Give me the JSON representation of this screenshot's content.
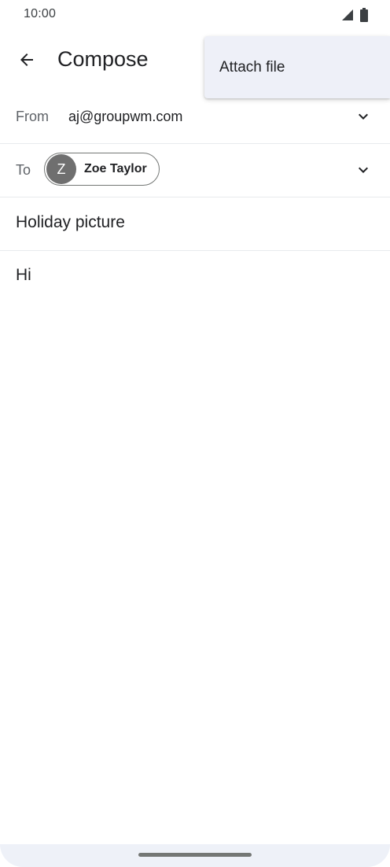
{
  "status_bar": {
    "time": "10:00",
    "icons": [
      "signal-icon",
      "battery-icon"
    ]
  },
  "app_bar": {
    "title": "Compose",
    "back_icon": "arrow-back-icon"
  },
  "from": {
    "label": "From",
    "value": "aj@groupwm.com",
    "expand_icon": "chevron-down-icon"
  },
  "to": {
    "label": "To",
    "recipients": [
      {
        "initial": "Z",
        "name": "Zoe Taylor"
      }
    ],
    "expand_icon": "chevron-down-icon"
  },
  "subject": {
    "value": "Holiday picture"
  },
  "body": {
    "value": "Hi"
  },
  "overflow_menu": {
    "items": [
      {
        "label": "Attach file"
      }
    ]
  },
  "colors": {
    "avatar_bg": "#6f6f6f",
    "menu_bg": "#eef0f8",
    "nav_bar_bg": "#eef1f8",
    "divider": "#e8eaed"
  }
}
